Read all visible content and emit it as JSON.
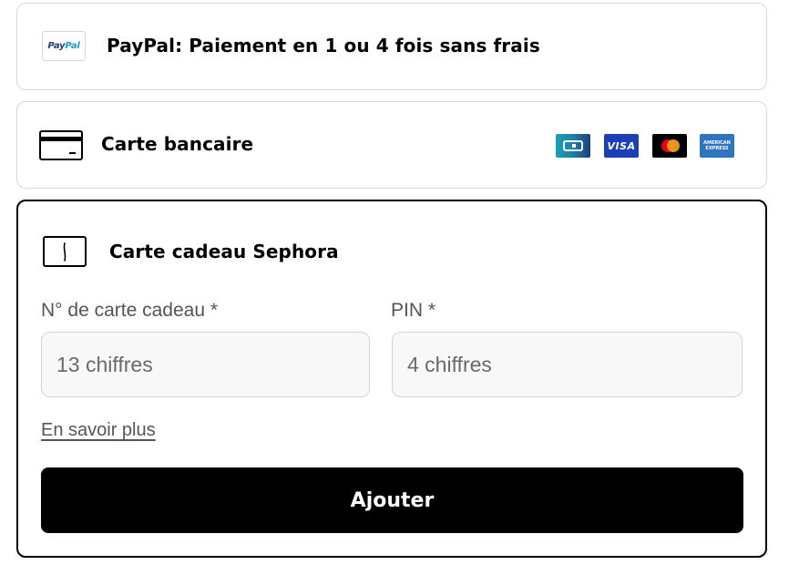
{
  "payment_options": {
    "paypal": {
      "title": "PayPal: Paiement en 1 ou 4 fois sans frais",
      "logo_text_pay": "Pay",
      "logo_text_pal": "Pal",
      "icon": "paypal-logo"
    },
    "carte_bancaire": {
      "title": "Carte bancaire",
      "icon": "credit-card-icon",
      "brands": [
        {
          "name": "cb-logo",
          "label": "CB"
        },
        {
          "name": "visa-logo",
          "label": "VISA"
        },
        {
          "name": "mastercard-logo",
          "label": ""
        },
        {
          "name": "amex-logo",
          "label_line1": "AMERICAN",
          "label_line2": "EXPRESS"
        }
      ]
    },
    "gift_card": {
      "title": "Carte cadeau Sephora",
      "icon": "gift-card-icon",
      "card_number": {
        "label": "N° de carte cadeau *",
        "placeholder": "13 chiffres",
        "value": ""
      },
      "pin": {
        "label": "PIN *",
        "placeholder": "4 chiffres",
        "value": ""
      },
      "learn_more_label": "En savoir plus",
      "add_button_label": "Ajouter"
    }
  },
  "colors": {
    "border_light": "#d8d8d8",
    "border_selected": "#000000",
    "button_bg": "#000000",
    "button_text": "#ffffff",
    "input_bg": "#f8f8f8"
  }
}
